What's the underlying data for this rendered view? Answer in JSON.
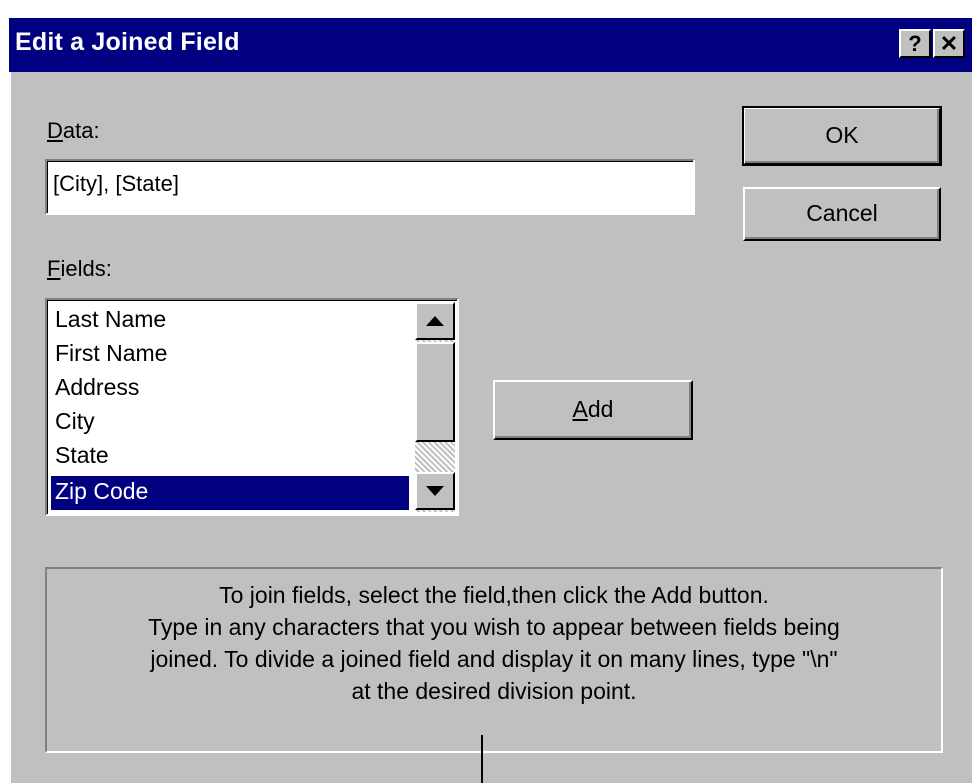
{
  "dialog": {
    "title": "Edit a Joined Field",
    "help_button": "?",
    "close_button": "✕"
  },
  "data_field": {
    "label_mnemonic": "D",
    "label_rest": "ata:",
    "value": "[City], [State]"
  },
  "fields": {
    "label_mnemonic": "F",
    "label_rest": "ields:",
    "items": [
      "Last Name",
      "First Name",
      "Address",
      "City",
      "State",
      "Zip Code"
    ],
    "selected": "Zip Code"
  },
  "buttons": {
    "ok": "OK",
    "cancel": "Cancel",
    "add_mnemonic": "A",
    "add_rest": "dd"
  },
  "help": {
    "line1": "To join fields, select the field,then click the Add button.",
    "line2": "Type in any characters that you wish to appear between fields being",
    "line3": "joined.  To divide a joined field and display it on many lines, type \"\\n\"",
    "line4": "at the desired division point."
  }
}
